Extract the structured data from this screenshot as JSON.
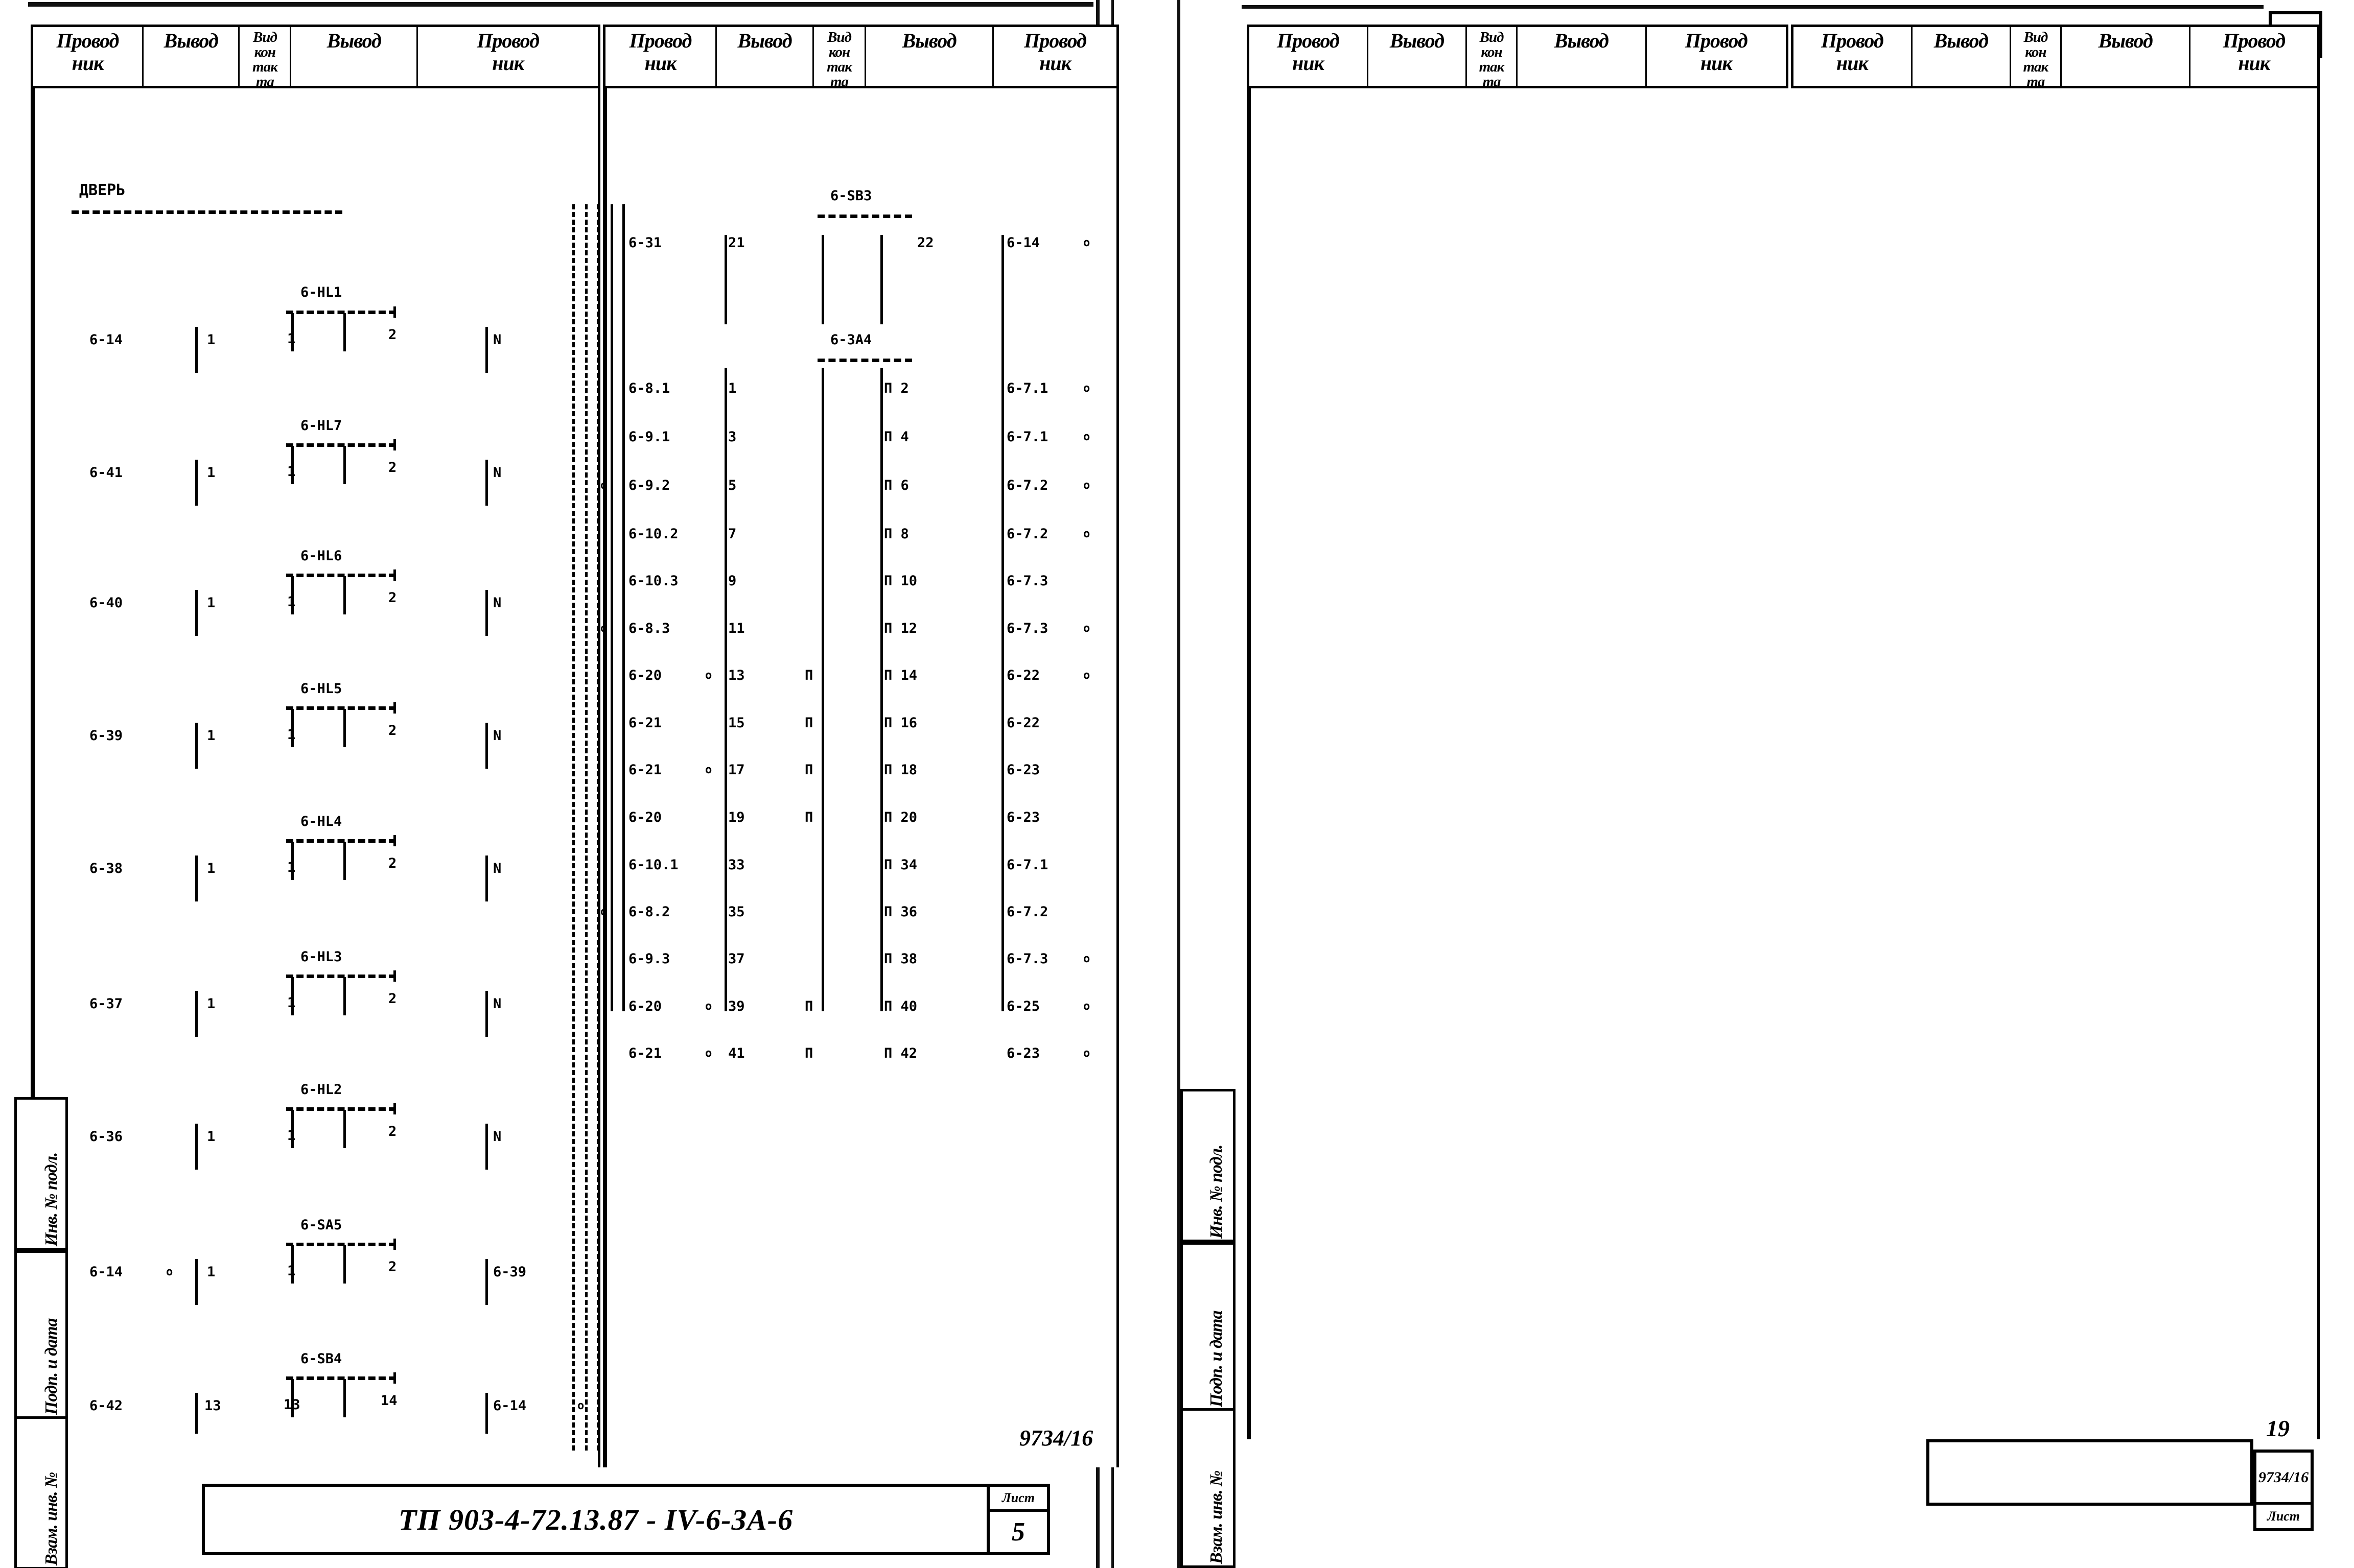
{
  "document": {
    "sheet_number_top_right": "19",
    "drawing_code": "ТП 903-4-72.13.87 - IV-6-ЗА-6",
    "doc_number": "9734/16",
    "sheet_label": "Лист",
    "sheet_value": "5",
    "right_sheet_number": "19",
    "right_doc_number": "9734/16",
    "right_sheet_label": "Лист"
  },
  "column_headers": {
    "conductor": "Провод",
    "conductor_2": "ник",
    "terminal": "Вывод",
    "contact_type_1": "Вид",
    "contact_type_2": "кон",
    "contact_type_3": "так",
    "contact_type_4": "та"
  },
  "left_sheet": {
    "header_columns": [
      {
        "name": "conductor",
        "lines": [
          "Провод",
          "ник"
        ]
      },
      {
        "name": "terminal",
        "lines": [
          "Вывод"
        ]
      },
      {
        "name": "contact-type",
        "lines": [
          "Вид",
          "кон",
          "так",
          "та"
        ]
      },
      {
        "name": "terminal",
        "lines": [
          "Вывод"
        ]
      },
      {
        "name": "conductor",
        "lines": [
          "Провод",
          "ник"
        ]
      },
      {
        "name": "conductor",
        "lines": [
          "Провод",
          "ник"
        ]
      },
      {
        "name": "terminal",
        "lines": [
          "Вывод"
        ]
      },
      {
        "name": "contact-type",
        "lines": [
          "Вид",
          "кон",
          "так",
          "та"
        ]
      },
      {
        "name": "terminal",
        "lines": [
          "Вывод"
        ]
      },
      {
        "name": "conductor",
        "lines": [
          "Провод",
          "ник"
        ]
      }
    ],
    "section_title": "ДВЕРЬ",
    "left_block": {
      "devices": [
        {
          "label": "6-HL1",
          "t1": "1",
          "t2": "2",
          "conductor": "6-14",
          "pin_left": "1",
          "pin_right": "N"
        },
        {
          "label": "6-HL7",
          "t1": "1",
          "t2": "2",
          "conductor": "6-41",
          "pin_left": "1",
          "pin_right": "N"
        },
        {
          "label": "6-HL6",
          "t1": "1",
          "t2": "2",
          "conductor": "6-40",
          "pin_left": "1",
          "pin_right": "N"
        },
        {
          "label": "6-HL5",
          "t1": "1",
          "t2": "2",
          "conductor": "6-39",
          "pin_left": "1",
          "pin_right": "N"
        },
        {
          "label": "6-HL4",
          "t1": "1",
          "t2": "2",
          "conductor": "6-38",
          "pin_left": "1",
          "pin_right": "N"
        },
        {
          "label": "6-HL3",
          "t1": "1",
          "t2": "2",
          "conductor": "6-37",
          "pin_left": "1",
          "pin_right": "N"
        },
        {
          "label": "6-HL2",
          "t1": "1",
          "t2": "2",
          "conductor": "6-36",
          "pin_left": "1",
          "pin_right": "N"
        },
        {
          "label": "6-SA5",
          "t1": "1",
          "t2": "2",
          "conductor": "6-14",
          "pin_left": "1",
          "pin_right": "6-39"
        },
        {
          "label": "6-SB4",
          "t1": "13",
          "t2": "14",
          "conductor": "6-42",
          "pin_left": "13",
          "pin_right": "6-14"
        }
      ]
    },
    "right_block": {
      "devices": [
        {
          "label": "6-SB3"
        },
        {
          "label": "6-3A4"
        }
      ],
      "rows": [
        {
          "c1": "6-31",
          "t1": "21",
          "k": "",
          "t2": "22",
          "c2": "6-14",
          "mark_left": "",
          "mark_right": "o"
        },
        {
          "c1": "6-8.1",
          "t1": "1",
          "k": "",
          "t2": "П 2",
          "c2": "6-7.1",
          "mark_left": "",
          "mark_right": "o"
        },
        {
          "c1": "6-9.1",
          "t1": "3",
          "k": "",
          "t2": "П 4",
          "c2": "6-7.1",
          "mark_left": "",
          "mark_right": "o"
        },
        {
          "c1": "6-9.2",
          "t1": "5",
          "k": "",
          "t2": "П 6",
          "c2": "6-7.2",
          "mark_left": "o",
          "mark_right": "o"
        },
        {
          "c1": "6-10.2",
          "t1": "7",
          "k": "",
          "t2": "П 8",
          "c2": "6-7.2",
          "mark_left": "",
          "mark_right": "o"
        },
        {
          "c1": "6-10.3",
          "t1": "9",
          "k": "",
          "t2": "П 10",
          "c2": "6-7.3",
          "mark_left": "",
          "mark_right": ""
        },
        {
          "c1": "6-8.3",
          "t1": "11",
          "k": "",
          "t2": "П 12",
          "c2": "6-7.3",
          "mark_left": "o",
          "mark_right": "o"
        },
        {
          "c1": "6-20",
          "t1": "13",
          "k": "П",
          "t2": "П 14",
          "c2": "6-22",
          "mark_left": "o",
          "mark_right": "o"
        },
        {
          "c1": "6-21",
          "t1": "15",
          "k": "П",
          "t2": "П 16",
          "c2": "6-22",
          "mark_left": "",
          "mark_right": ""
        },
        {
          "c1": "6-21",
          "t1": "17",
          "k": "П",
          "t2": "П 18",
          "c2": "6-23",
          "mark_left": "o",
          "mark_right": ""
        },
        {
          "c1": "6-20",
          "t1": "19",
          "k": "П",
          "t2": "П 20",
          "c2": "6-23",
          "mark_left": "",
          "mark_right": ""
        },
        {
          "c1": "6-10.1",
          "t1": "33",
          "k": "",
          "t2": "П 34",
          "c2": "6-7.1",
          "mark_left": "",
          "mark_right": ""
        },
        {
          "c1": "6-8.2",
          "t1": "35",
          "k": "",
          "t2": "П 36",
          "c2": "6-7.2",
          "mark_left": "o",
          "mark_right": ""
        },
        {
          "c1": "6-9.3",
          "t1": "37",
          "k": "",
          "t2": "П 38",
          "c2": "6-7.3",
          "mark_left": "",
          "mark_right": "o"
        },
        {
          "c1": "6-20",
          "t1": "39",
          "k": "П",
          "t2": "П 40",
          "c2": "6-25",
          "mark_left": "o",
          "mark_right": "o"
        },
        {
          "c1": "6-21",
          "t1": "41",
          "k": "П",
          "t2": "П 42",
          "c2": "6-23",
          "mark_left": "o",
          "mark_right": "o"
        }
      ]
    },
    "margin_labels": [
      "Инв. № подл.",
      "Подп. и дата",
      "Взам. инв. №"
    ]
  },
  "right_sheet": {
    "header_columns": [
      {
        "name": "conductor",
        "lines": [
          "Провод",
          "ник"
        ]
      },
      {
        "name": "terminal",
        "lines": [
          "Вывод"
        ]
      },
      {
        "name": "contact-type",
        "lines": [
          "Вид",
          "кон",
          "так",
          "та"
        ]
      },
      {
        "name": "terminal",
        "lines": [
          "Вывод"
        ]
      },
      {
        "name": "conductor",
        "lines": [
          "Провод",
          "ник"
        ]
      },
      {
        "name": "conductor",
        "lines": [
          "Провод",
          "ник"
        ]
      },
      {
        "name": "terminal",
        "lines": [
          "Вывод"
        ]
      },
      {
        "name": "contact-type",
        "lines": [
          "Вид",
          "кон",
          "так",
          "та"
        ]
      },
      {
        "name": "terminal",
        "lines": [
          "Вывод"
        ]
      },
      {
        "name": "conductor",
        "lines": [
          "Провод",
          "ник"
        ]
      }
    ],
    "margin_labels": [
      "Инв. № подл.",
      "Подп. и дата",
      "Взам. инв. №"
    ]
  },
  "colors": {
    "ink": "#000000",
    "paper": "#ffffff"
  }
}
